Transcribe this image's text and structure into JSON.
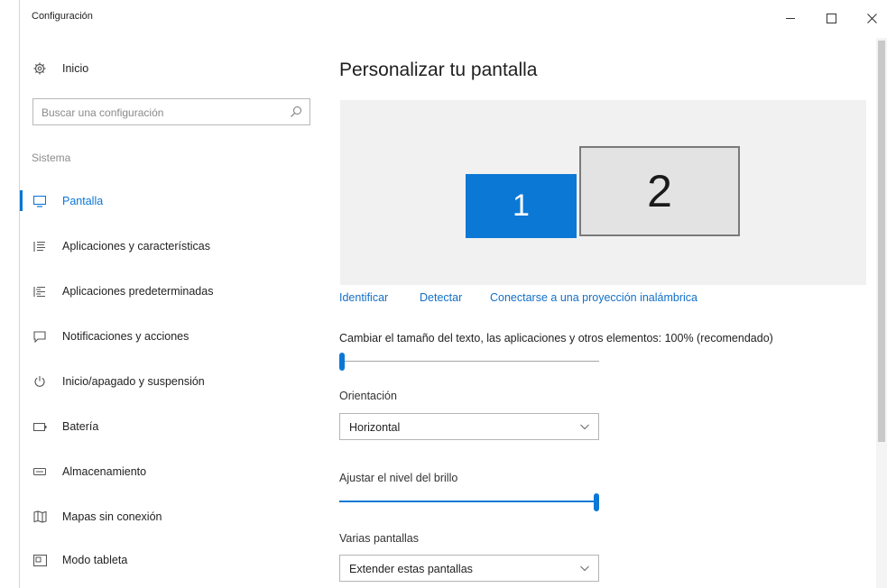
{
  "window": {
    "title": "Configuración"
  },
  "sidebar": {
    "home_label": "Inicio",
    "search_placeholder": "Buscar una configuración",
    "section_label": "Sistema",
    "items": [
      {
        "label": "Pantalla",
        "icon": "monitor-icon",
        "active": true
      },
      {
        "label": "Aplicaciones y características",
        "icon": "apps-list-icon",
        "active": false
      },
      {
        "label": "Aplicaciones predeterminadas",
        "icon": "default-apps-icon",
        "active": false
      },
      {
        "label": "Notificaciones y acciones",
        "icon": "notification-icon",
        "active": false
      },
      {
        "label": "Inicio/apagado y suspensión",
        "icon": "power-icon",
        "active": false
      },
      {
        "label": "Batería",
        "icon": "battery-icon",
        "active": false
      },
      {
        "label": "Almacenamiento",
        "icon": "storage-icon",
        "active": false
      },
      {
        "label": "Mapas sin conexión",
        "icon": "map-icon",
        "active": false
      },
      {
        "label": "Modo tableta",
        "icon": "tablet-icon",
        "active": false
      }
    ]
  },
  "main": {
    "title": "Personalizar tu pantalla",
    "monitors": [
      {
        "number": "1",
        "selected": true
      },
      {
        "number": "2",
        "selected": false
      }
    ],
    "links": {
      "identify": "Identificar",
      "detect": "Detectar",
      "wireless": "Conectarse a una proyección inalámbrica"
    },
    "scale_label": "Cambiar el tamaño del texto, las aplicaciones y otros elementos: 100% (recomendado)",
    "scale_slider_value": 0,
    "orientation_label": "Orientación",
    "orientation_value": "Horizontal",
    "brightness_label": "Ajustar el nivel del brillo",
    "brightness_value": 100,
    "multi_display_label": "Varias pantallas",
    "multi_display_value": "Extender estas pantallas"
  },
  "colors": {
    "accent": "#0b78d6",
    "link": "#1370c7"
  }
}
